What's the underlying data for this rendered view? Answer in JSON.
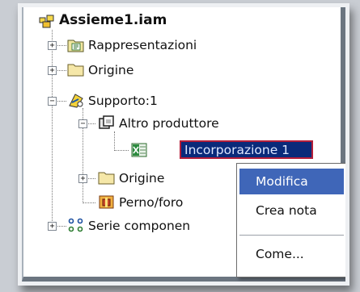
{
  "tree": {
    "root": "Assieme1.iam",
    "items": [
      {
        "label": "Rappresentazioni"
      },
      {
        "label": "Origine"
      },
      {
        "label": "Supporto:1"
      },
      {
        "label": "Altro produttore"
      },
      {
        "label": "Incorporazione 1"
      },
      {
        "label": "Origine"
      },
      {
        "label": "Perno/foro"
      },
      {
        "label": "Serie componen"
      }
    ],
    "expander_plus": "+",
    "expander_minus": "−"
  },
  "context_menu": {
    "items": [
      "Modifica",
      "Crea nota",
      "Come..."
    ]
  },
  "colors": {
    "selection": "#0a2a7a",
    "selection_border": "#b41e3a",
    "menu_highlight": "#3f66b8"
  }
}
